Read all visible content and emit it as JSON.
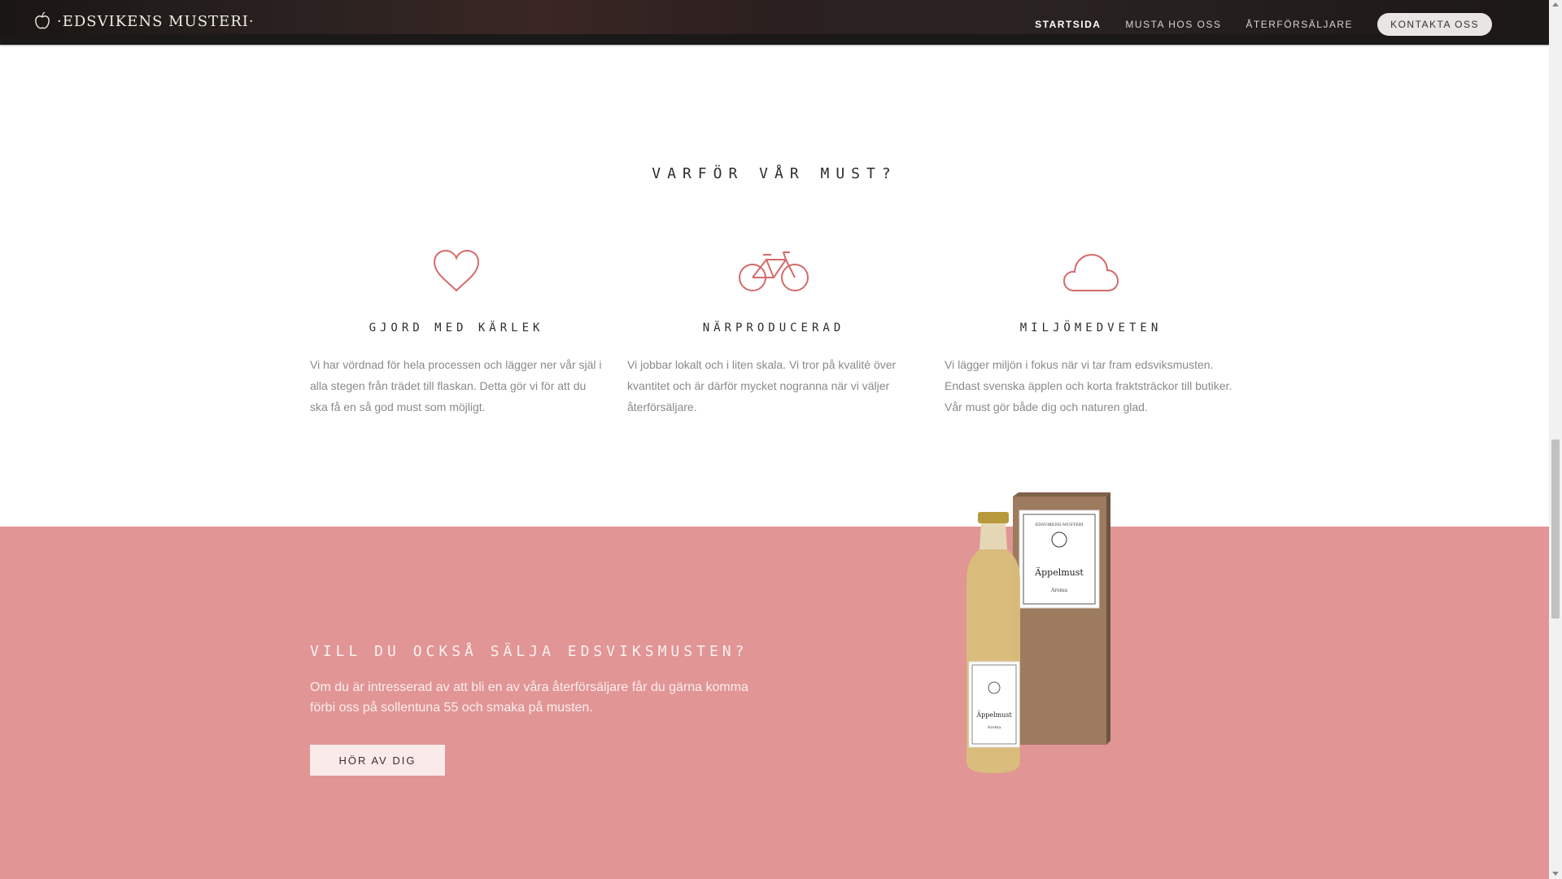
{
  "nav": {
    "logo_text": "·EDSVIKENS MUSTERI·",
    "links": [
      {
        "label": "STARTSIDA",
        "active": true
      },
      {
        "label": "MUSTA HOS OSS",
        "active": false
      },
      {
        "label": "ÅTERFÖRSÄLJARE",
        "active": false
      }
    ],
    "contact_label": "KONTAKTA OSS"
  },
  "why": {
    "title": "VARFÖR VÅR MUST?",
    "features": [
      {
        "icon": "heart-icon",
        "title": "GJORD MED KÄRLEK",
        "text": "Vi har vördnad för hela processen och lägger ner vår själ i alla stegen från trädet till flaskan. Detta gör vi för att du ska få en så god must som möjligt."
      },
      {
        "icon": "bicycle-icon",
        "title": "NÄRPRODUCERAD",
        "text": "Vi jobbar lokalt och i liten skala. Vi tror på kvalité över kvantitet och är därför mycket nogranna när vi väljer återförsäljare."
      },
      {
        "icon": "cloud-icon",
        "title": "MILJÖMEDVETEN",
        "text": "Vi lägger miljön i fokus när vi tar fram edsviksmusten. Endast svenska äpplen och korta fraktsträckor till butiker. Vår must gör både dig och naturen glad."
      }
    ]
  },
  "cta": {
    "title": "VILL DU OCKSÅ SÄLJA EDSVIKSMUSTEN?",
    "text": "Om du är intresserad av att bli en av våra återförsäljare får du gärna komma förbi oss på sollentuna 55 och smaka på musten.",
    "button_label": "HÖR AV DIG"
  },
  "product": {
    "box_brand": "EDSVIKENS MUSTERI",
    "box_label": "Äppelmust",
    "box_sub": "Aroma",
    "bottle_label": "Äppelmust",
    "bottle_sub": "Aroma"
  },
  "colors": {
    "accent": "#d46a6a",
    "pink_bg": "#e19595"
  }
}
